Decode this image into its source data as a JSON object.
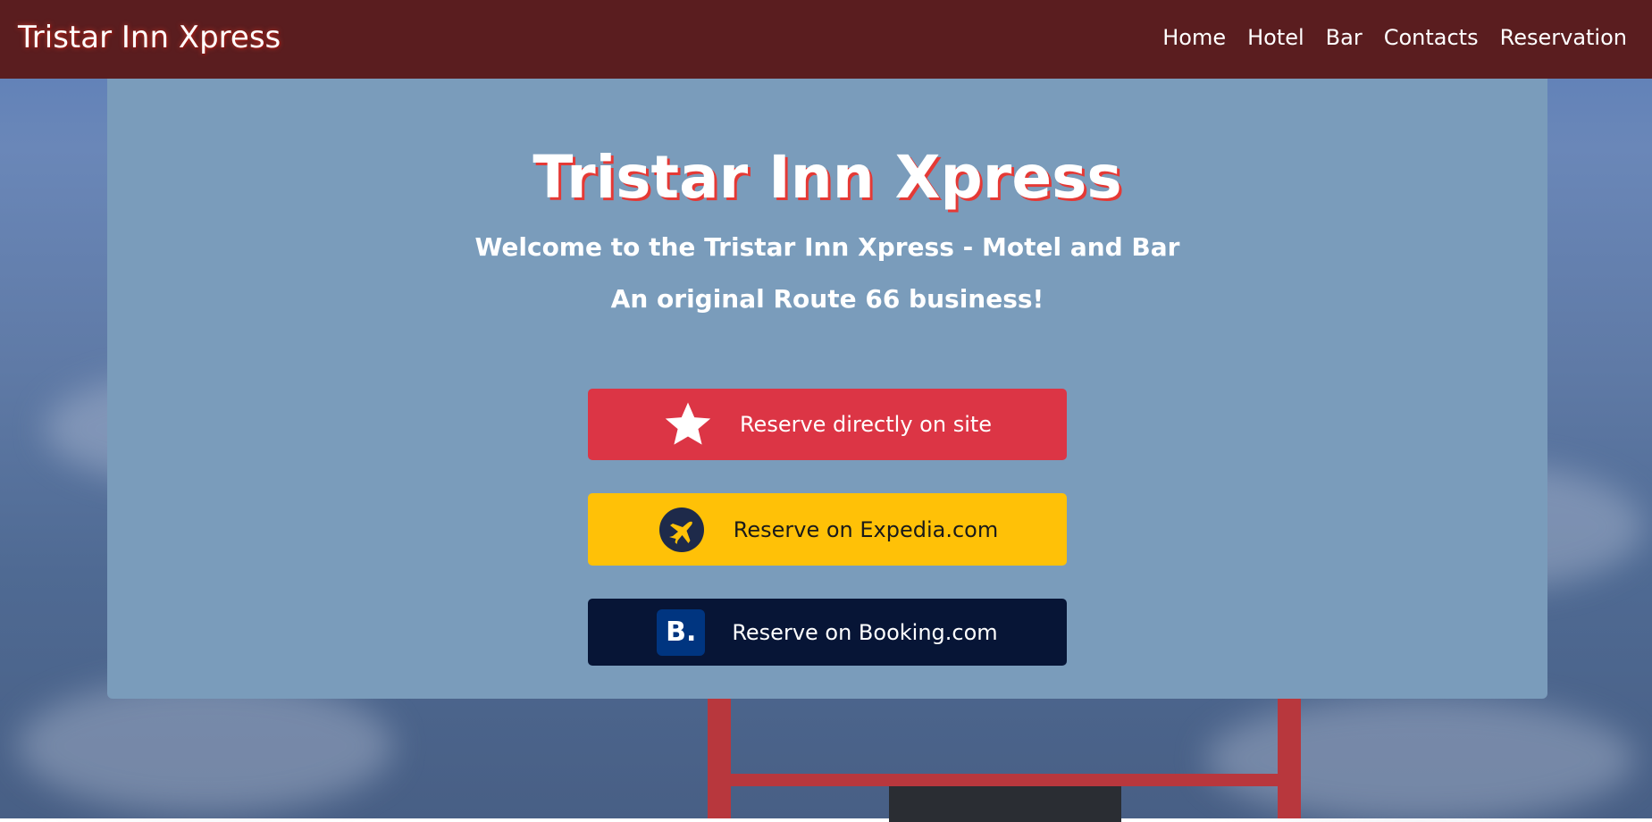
{
  "navbar": {
    "brand": "Tristar Inn Xpress",
    "links": [
      "Home",
      "Hotel",
      "Bar",
      "Contacts",
      "Reservation"
    ]
  },
  "hero": {
    "title": "Tristar Inn Xpress",
    "subtitle": "Welcome to the Tristar Inn Xpress - Motel and Bar",
    "tagline": "An original Route 66 business!"
  },
  "buttons": {
    "direct": {
      "label": "Reserve directly on site",
      "icon": "star-icon",
      "color": "#dc3545"
    },
    "expedia": {
      "label": "Reserve on Expedia.com",
      "icon": "expedia-plane-icon",
      "color": "#ffc107"
    },
    "booking": {
      "label": "Reserve on Booking.com",
      "icon": "booking-logo-icon",
      "icon_text": "B.",
      "color": "#071536"
    }
  },
  "colors": {
    "navbar": "#5a1d1f",
    "panel": "#7a9cbb",
    "title_shadow": "#e53935"
  }
}
